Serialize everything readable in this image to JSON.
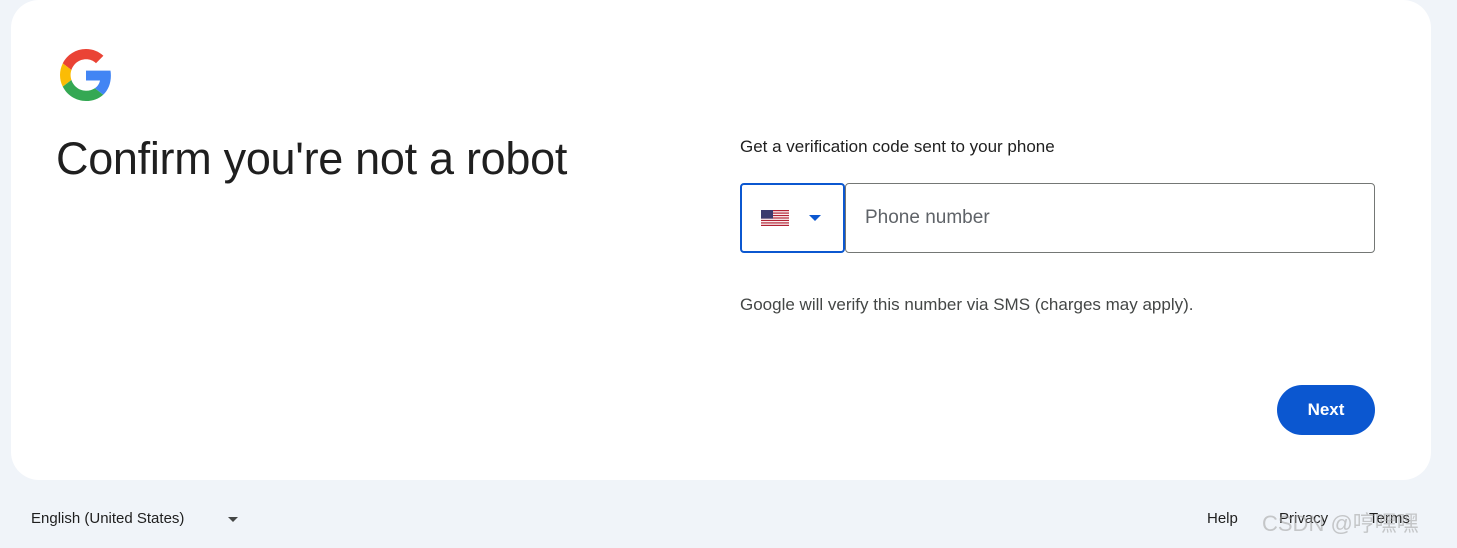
{
  "header": {
    "logo_icon": "google-g-logo",
    "title": "Confirm you're not a robot"
  },
  "form": {
    "subtitle": "Get a verification code sent to your phone",
    "country": {
      "flag_icon": "us-flag-icon",
      "selected": "United States"
    },
    "phone": {
      "placeholder": "Phone number",
      "value": ""
    },
    "helper_text": "Google will verify this number via SMS (charges may apply).",
    "next_label": "Next"
  },
  "footer": {
    "language": "English (United States)",
    "links": {
      "help": "Help",
      "privacy": "Privacy",
      "terms": "Terms"
    }
  },
  "watermark": "CSDN @哼嘿嘿",
  "colors": {
    "accent": "#0b57d0",
    "page_background": "#f0f4f9",
    "card_background": "#ffffff",
    "text": "#1f1f1f"
  }
}
